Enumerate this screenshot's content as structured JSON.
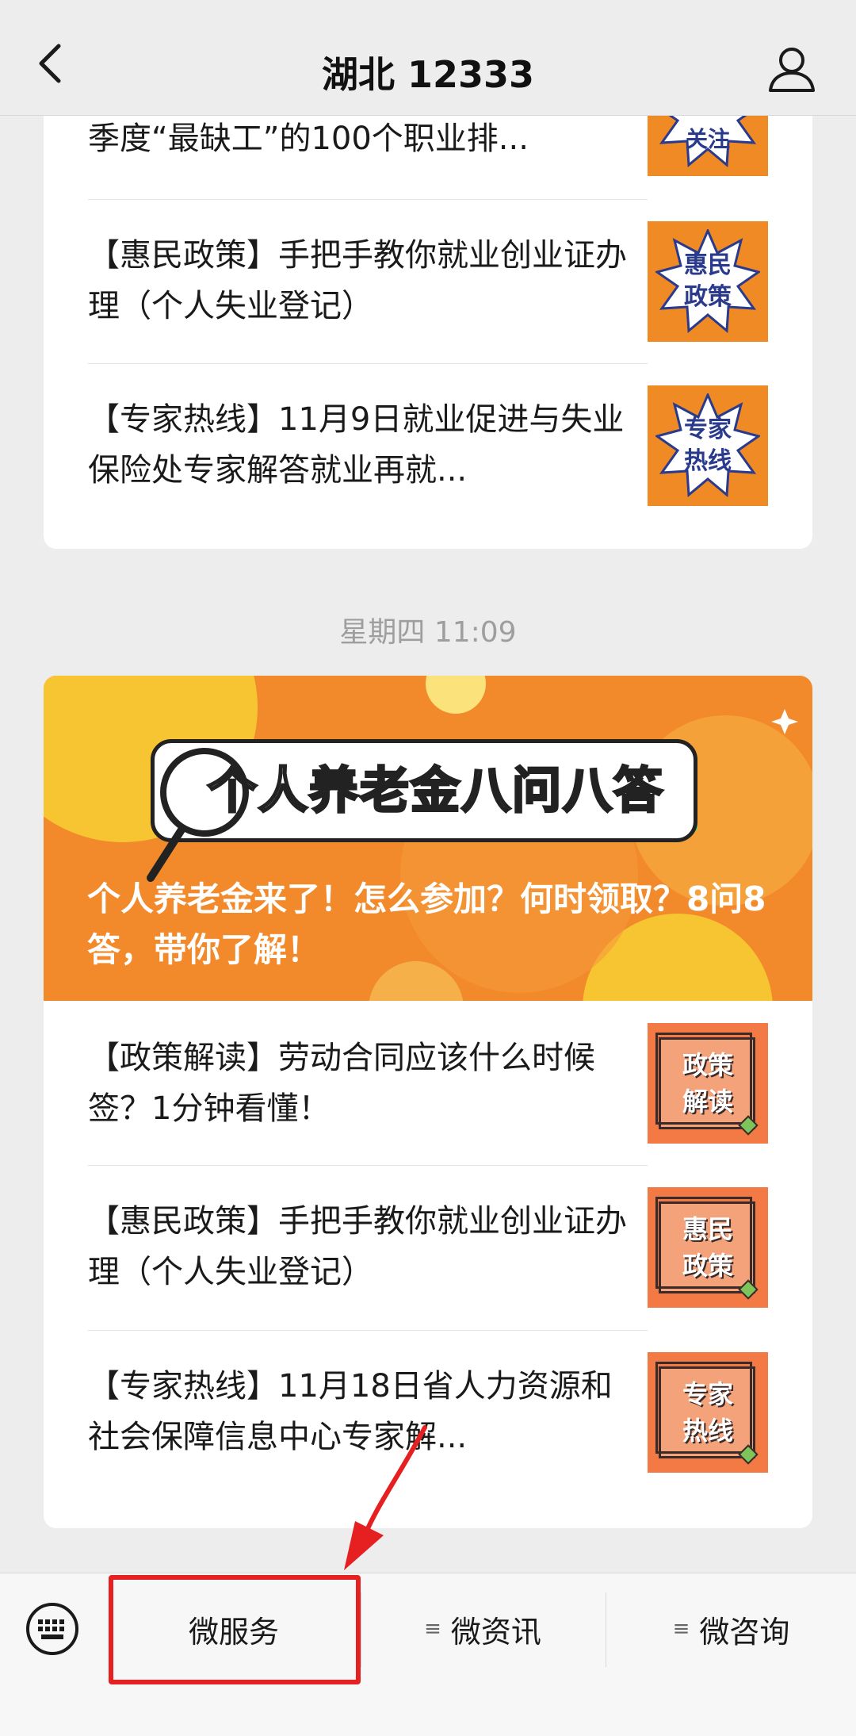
{
  "nav": {
    "title": "湖北 12333",
    "back_icon": "chevron-left-icon",
    "profile_icon": "person-icon"
  },
  "first_card": {
    "rows": [
      {
        "text": "季度“最缺工”的100个职业排...",
        "thumb_lines": [
          "关",
          "注"
        ]
      },
      {
        "text": "【惠民政策】手把手教你就业创业证办理（个人失业登记）",
        "thumb_lines": [
          "惠民",
          "政策"
        ]
      },
      {
        "text": "【专家热线】11月9日就业促进与失业保险处专家解答就业再就...",
        "thumb_lines": [
          "专家",
          "热线"
        ]
      }
    ]
  },
  "timestamp": "星期四 11:09",
  "second_card": {
    "banner": {
      "title": "个人养老金八问八答",
      "caption": "个人养老金来了！怎么参加？何时领取？8问8答，带你了解！"
    },
    "rows": [
      {
        "text": "【政策解读】劳动合同应该什么时候签？1分钟看懂！",
        "thumb_lines": [
          "政策",
          "解读"
        ]
      },
      {
        "text": "【惠民政策】手把手教你就业创业证办理（个人失业登记）",
        "thumb_lines": [
          "惠民",
          "政策"
        ]
      },
      {
        "text": "【专家热线】11月18日省人力资源和社会保障信息中心专家解...",
        "thumb_lines": [
          "专家",
          "热线"
        ]
      }
    ]
  },
  "bottom_menu": {
    "keyboard_icon": "keyboard-icon",
    "items": [
      {
        "label": "微服务",
        "icon": ""
      },
      {
        "label": "微资讯",
        "icon": "≡"
      },
      {
        "label": "微咨询",
        "icon": "≡"
      }
    ]
  },
  "colors": {
    "highlight": "#e62020",
    "thumb_orange": "#f08a24",
    "thumb_coral": "#f47a45",
    "banner_orange": "#f2892a"
  }
}
